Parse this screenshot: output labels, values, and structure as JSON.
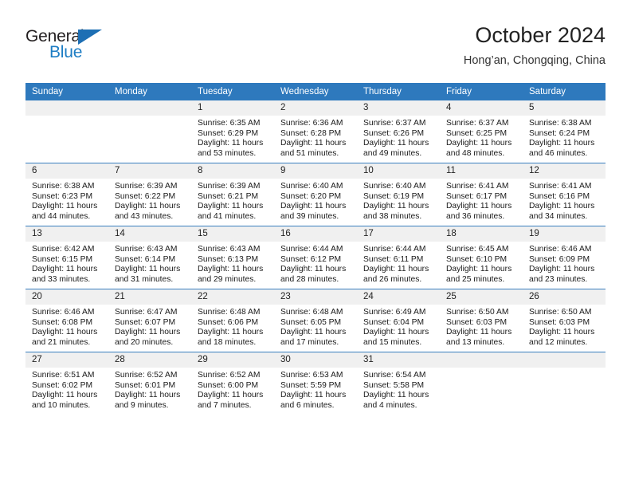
{
  "brand": {
    "name_part1": "General",
    "name_part2": "Blue",
    "triangle_color": "#1d6fb4"
  },
  "header": {
    "title": "October 2024",
    "subtitle": "Hong’an, Chongqing, China"
  },
  "theme": {
    "header_blue": "#2e79bd",
    "daynum_gray": "#f0f0f0",
    "brand_blue": "#1d7dc4"
  },
  "weekdays": [
    "Sunday",
    "Monday",
    "Tuesday",
    "Wednesday",
    "Thursday",
    "Friday",
    "Saturday"
  ],
  "weeks": [
    [
      {
        "day": "",
        "sunrise": "",
        "sunset": "",
        "daylight1": "",
        "daylight2": ""
      },
      {
        "day": "",
        "sunrise": "",
        "sunset": "",
        "daylight1": "",
        "daylight2": ""
      },
      {
        "day": "1",
        "sunrise": "Sunrise: 6:35 AM",
        "sunset": "Sunset: 6:29 PM",
        "daylight1": "Daylight: 11 hours",
        "daylight2": "and 53 minutes."
      },
      {
        "day": "2",
        "sunrise": "Sunrise: 6:36 AM",
        "sunset": "Sunset: 6:28 PM",
        "daylight1": "Daylight: 11 hours",
        "daylight2": "and 51 minutes."
      },
      {
        "day": "3",
        "sunrise": "Sunrise: 6:37 AM",
        "sunset": "Sunset: 6:26 PM",
        "daylight1": "Daylight: 11 hours",
        "daylight2": "and 49 minutes."
      },
      {
        "day": "4",
        "sunrise": "Sunrise: 6:37 AM",
        "sunset": "Sunset: 6:25 PM",
        "daylight1": "Daylight: 11 hours",
        "daylight2": "and 48 minutes."
      },
      {
        "day": "5",
        "sunrise": "Sunrise: 6:38 AM",
        "sunset": "Sunset: 6:24 PM",
        "daylight1": "Daylight: 11 hours",
        "daylight2": "and 46 minutes."
      }
    ],
    [
      {
        "day": "6",
        "sunrise": "Sunrise: 6:38 AM",
        "sunset": "Sunset: 6:23 PM",
        "daylight1": "Daylight: 11 hours",
        "daylight2": "and 44 minutes."
      },
      {
        "day": "7",
        "sunrise": "Sunrise: 6:39 AM",
        "sunset": "Sunset: 6:22 PM",
        "daylight1": "Daylight: 11 hours",
        "daylight2": "and 43 minutes."
      },
      {
        "day": "8",
        "sunrise": "Sunrise: 6:39 AM",
        "sunset": "Sunset: 6:21 PM",
        "daylight1": "Daylight: 11 hours",
        "daylight2": "and 41 minutes."
      },
      {
        "day": "9",
        "sunrise": "Sunrise: 6:40 AM",
        "sunset": "Sunset: 6:20 PM",
        "daylight1": "Daylight: 11 hours",
        "daylight2": "and 39 minutes."
      },
      {
        "day": "10",
        "sunrise": "Sunrise: 6:40 AM",
        "sunset": "Sunset: 6:19 PM",
        "daylight1": "Daylight: 11 hours",
        "daylight2": "and 38 minutes."
      },
      {
        "day": "11",
        "sunrise": "Sunrise: 6:41 AM",
        "sunset": "Sunset: 6:17 PM",
        "daylight1": "Daylight: 11 hours",
        "daylight2": "and 36 minutes."
      },
      {
        "day": "12",
        "sunrise": "Sunrise: 6:41 AM",
        "sunset": "Sunset: 6:16 PM",
        "daylight1": "Daylight: 11 hours",
        "daylight2": "and 34 minutes."
      }
    ],
    [
      {
        "day": "13",
        "sunrise": "Sunrise: 6:42 AM",
        "sunset": "Sunset: 6:15 PM",
        "daylight1": "Daylight: 11 hours",
        "daylight2": "and 33 minutes."
      },
      {
        "day": "14",
        "sunrise": "Sunrise: 6:43 AM",
        "sunset": "Sunset: 6:14 PM",
        "daylight1": "Daylight: 11 hours",
        "daylight2": "and 31 minutes."
      },
      {
        "day": "15",
        "sunrise": "Sunrise: 6:43 AM",
        "sunset": "Sunset: 6:13 PM",
        "daylight1": "Daylight: 11 hours",
        "daylight2": "and 29 minutes."
      },
      {
        "day": "16",
        "sunrise": "Sunrise: 6:44 AM",
        "sunset": "Sunset: 6:12 PM",
        "daylight1": "Daylight: 11 hours",
        "daylight2": "and 28 minutes."
      },
      {
        "day": "17",
        "sunrise": "Sunrise: 6:44 AM",
        "sunset": "Sunset: 6:11 PM",
        "daylight1": "Daylight: 11 hours",
        "daylight2": "and 26 minutes."
      },
      {
        "day": "18",
        "sunrise": "Sunrise: 6:45 AM",
        "sunset": "Sunset: 6:10 PM",
        "daylight1": "Daylight: 11 hours",
        "daylight2": "and 25 minutes."
      },
      {
        "day": "19",
        "sunrise": "Sunrise: 6:46 AM",
        "sunset": "Sunset: 6:09 PM",
        "daylight1": "Daylight: 11 hours",
        "daylight2": "and 23 minutes."
      }
    ],
    [
      {
        "day": "20",
        "sunrise": "Sunrise: 6:46 AM",
        "sunset": "Sunset: 6:08 PM",
        "daylight1": "Daylight: 11 hours",
        "daylight2": "and 21 minutes."
      },
      {
        "day": "21",
        "sunrise": "Sunrise: 6:47 AM",
        "sunset": "Sunset: 6:07 PM",
        "daylight1": "Daylight: 11 hours",
        "daylight2": "and 20 minutes."
      },
      {
        "day": "22",
        "sunrise": "Sunrise: 6:48 AM",
        "sunset": "Sunset: 6:06 PM",
        "daylight1": "Daylight: 11 hours",
        "daylight2": "and 18 minutes."
      },
      {
        "day": "23",
        "sunrise": "Sunrise: 6:48 AM",
        "sunset": "Sunset: 6:05 PM",
        "daylight1": "Daylight: 11 hours",
        "daylight2": "and 17 minutes."
      },
      {
        "day": "24",
        "sunrise": "Sunrise: 6:49 AM",
        "sunset": "Sunset: 6:04 PM",
        "daylight1": "Daylight: 11 hours",
        "daylight2": "and 15 minutes."
      },
      {
        "day": "25",
        "sunrise": "Sunrise: 6:50 AM",
        "sunset": "Sunset: 6:03 PM",
        "daylight1": "Daylight: 11 hours",
        "daylight2": "and 13 minutes."
      },
      {
        "day": "26",
        "sunrise": "Sunrise: 6:50 AM",
        "sunset": "Sunset: 6:03 PM",
        "daylight1": "Daylight: 11 hours",
        "daylight2": "and 12 minutes."
      }
    ],
    [
      {
        "day": "27",
        "sunrise": "Sunrise: 6:51 AM",
        "sunset": "Sunset: 6:02 PM",
        "daylight1": "Daylight: 11 hours",
        "daylight2": "and 10 minutes."
      },
      {
        "day": "28",
        "sunrise": "Sunrise: 6:52 AM",
        "sunset": "Sunset: 6:01 PM",
        "daylight1": "Daylight: 11 hours",
        "daylight2": "and 9 minutes."
      },
      {
        "day": "29",
        "sunrise": "Sunrise: 6:52 AM",
        "sunset": "Sunset: 6:00 PM",
        "daylight1": "Daylight: 11 hours",
        "daylight2": "and 7 minutes."
      },
      {
        "day": "30",
        "sunrise": "Sunrise: 6:53 AM",
        "sunset": "Sunset: 5:59 PM",
        "daylight1": "Daylight: 11 hours",
        "daylight2": "and 6 minutes."
      },
      {
        "day": "31",
        "sunrise": "Sunrise: 6:54 AM",
        "sunset": "Sunset: 5:58 PM",
        "daylight1": "Daylight: 11 hours",
        "daylight2": "and 4 minutes."
      },
      {
        "day": "",
        "sunrise": "",
        "sunset": "",
        "daylight1": "",
        "daylight2": ""
      },
      {
        "day": "",
        "sunrise": "",
        "sunset": "",
        "daylight1": "",
        "daylight2": ""
      }
    ]
  ]
}
